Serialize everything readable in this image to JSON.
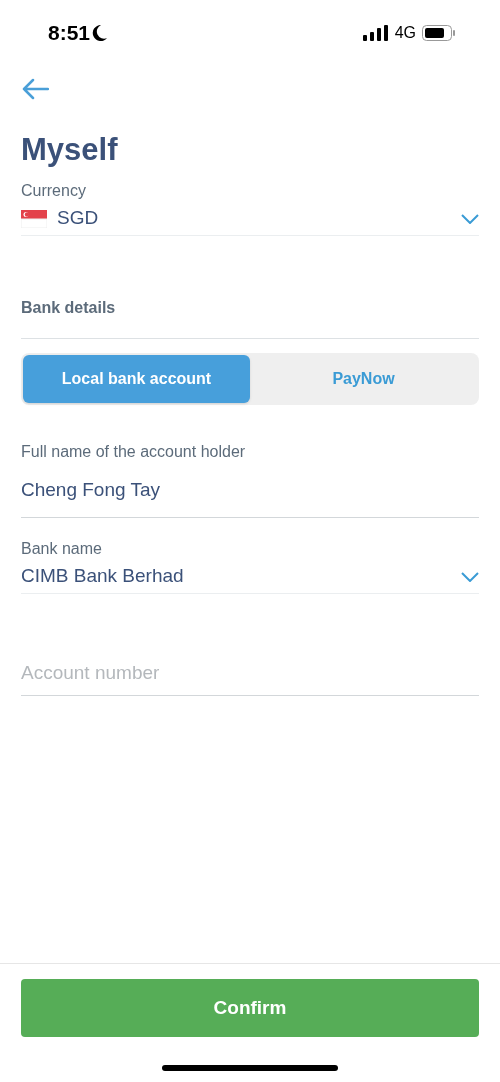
{
  "status_bar": {
    "time": "8:51",
    "network": "4G"
  },
  "title": "Myself",
  "currency": {
    "label": "Currency",
    "value": "SGD"
  },
  "bank_details": {
    "heading": "Bank details"
  },
  "tabs": [
    {
      "label": "Local bank account",
      "selected": true
    },
    {
      "label": "PayNow",
      "selected": false
    }
  ],
  "account_holder": {
    "label": "Full name of the account holder",
    "value": "Cheng Fong Tay"
  },
  "bank_name": {
    "label": "Bank name",
    "value": "CIMB Bank Berhad"
  },
  "account_number": {
    "placeholder": "Account number"
  },
  "confirm_button": "Confirm"
}
